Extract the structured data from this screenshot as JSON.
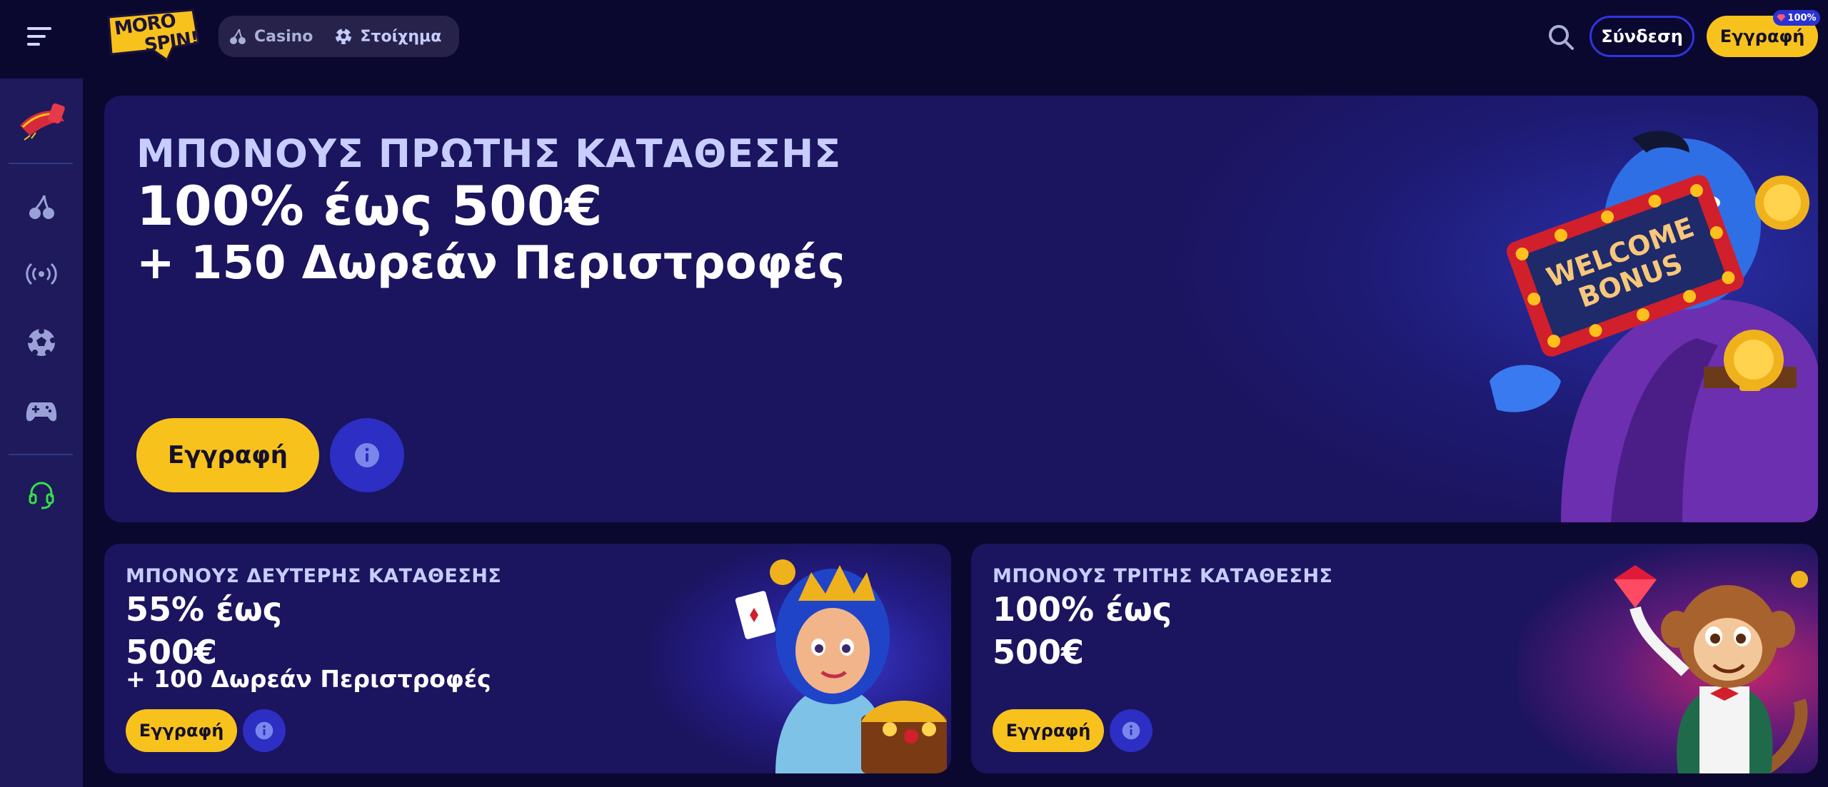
{
  "header": {
    "logo_line1": "MORO",
    "logo_line2": "SPIN!",
    "switcher": [
      {
        "label": "Casino",
        "icon": "cherries-icon"
      },
      {
        "label": "Στοίχημα",
        "icon": "soccer-ball-icon"
      }
    ],
    "login_label": "Σύνδεση",
    "register_label": "Εγγραφή",
    "register_badge": "100%"
  },
  "sidebar": {
    "items": [
      "magic-carpet-icon",
      "cherries-icon",
      "live-broadcast-icon",
      "soccer-ball-icon",
      "gamepad-icon",
      "support-headset-icon"
    ]
  },
  "hero": {
    "subtitle": "ΜΠΟΝΟΥΣ ΠΡΩΤΗΣ ΚΑΤΑΘΕΣΗΣ",
    "title": "100% έως 500€",
    "title2": "+ 150 Δωρεάν Περιστροφές",
    "register_label": "Εγγραφή",
    "sign_text1": "WELCOME",
    "sign_text2": "BONUS"
  },
  "cards": [
    {
      "subtitle": "ΜΠΟΝΟΥΣ ΔΕΥΤΕΡΗΣ ΚΑΤΑΘΕΣΗΣ",
      "title_line1": "55% έως",
      "title_line2": "500€",
      "extra": "+ 100 Δωρεάν Περιστροφές",
      "register_label": "Εγγραφή"
    },
    {
      "subtitle": "ΜΠΟΝΟΥΣ ΤΡΙΤΗΣ ΚΑΤΑΘΕΣΗΣ",
      "title_line1": "100% έως",
      "title_line2": "500€",
      "register_label": "Εγγραφή"
    }
  ],
  "colors": {
    "background": "#0b0830",
    "sidebar": "#1e1a5c",
    "card": "#1b145e",
    "accent_yellow": "#f8c21c",
    "accent_blue": "#2d2ec4",
    "support_green": "#35e04a"
  }
}
